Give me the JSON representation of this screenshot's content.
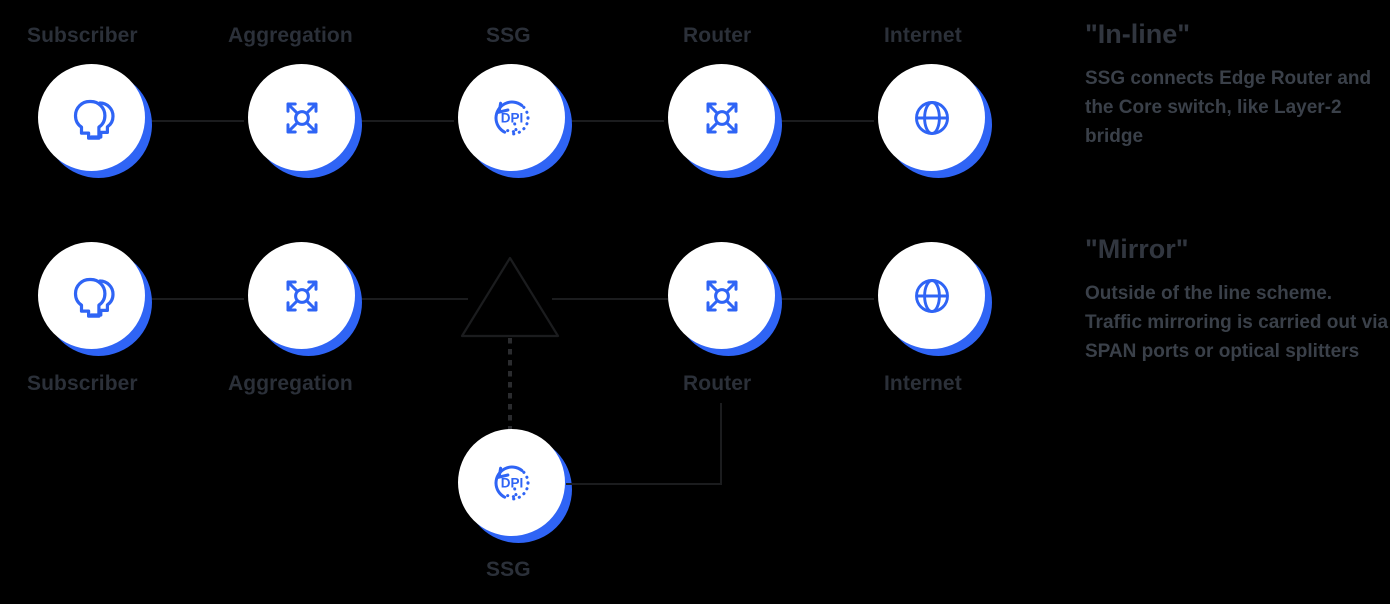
{
  "diagram": {
    "rows": [
      {
        "id": "in-line",
        "labels_position": "above",
        "nodes": [
          {
            "label": "Subscriber",
            "icon": "subscriber-heads-icon"
          },
          {
            "label": "Aggregation",
            "icon": "aggregation-switch-icon"
          },
          {
            "label": "SSG",
            "icon": "dpi-refresh-icon"
          },
          {
            "label": "Router",
            "icon": "router-switch-icon"
          },
          {
            "label": "Internet",
            "icon": "globe-icon"
          }
        ]
      },
      {
        "id": "mirror",
        "labels_position": "below",
        "nodes": [
          {
            "label": "Subscriber",
            "icon": "subscriber-heads-icon"
          },
          {
            "label": "Aggregation",
            "icon": "aggregation-switch-icon"
          },
          {
            "label": "Router",
            "icon": "router-switch-icon"
          },
          {
            "label": "Internet",
            "icon": "globe-icon"
          }
        ],
        "offline_node": {
          "label": "SSG",
          "icon": "dpi-refresh-icon"
        },
        "splitter": {
          "name": "optical-splitter-triangle"
        }
      }
    ],
    "dpi_icon_text": "DPI"
  },
  "panels": [
    {
      "title": "\"In-line\"",
      "body": "SSG connects Edge Router and the Core switch, like Layer-2 bridge"
    },
    {
      "title": "\"Mirror\"",
      "body": "Outside of the line scheme. Traffic mirroring is carried out via SPAN ports or optical splitters"
    }
  ],
  "colors": {
    "accent_blue": "#2f64f5",
    "node_face": "#ffffff",
    "label_text": "#2b3039",
    "panel_title": "#31363f",
    "panel_body": "#3a4049",
    "link": "#1b1c1e",
    "background": "#000000"
  }
}
